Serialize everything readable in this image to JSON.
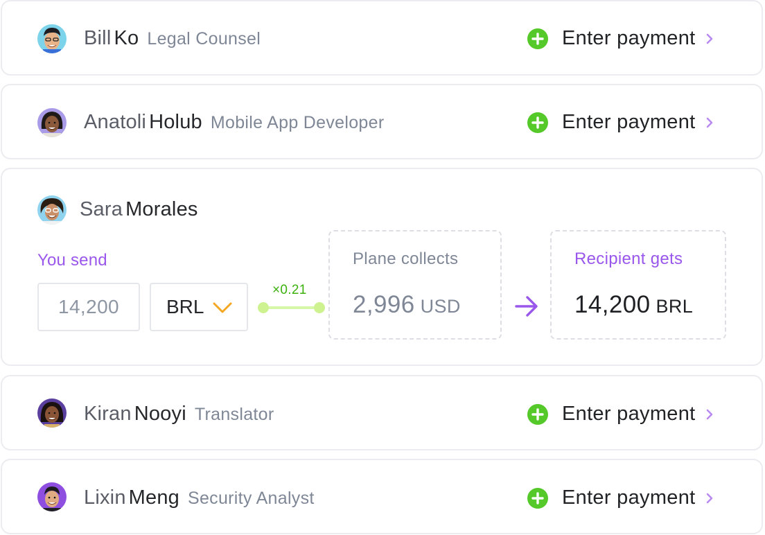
{
  "colors": {
    "accent_purple": "#9a57ec",
    "plus_green": "#56c92a",
    "rate_green": "#3cb10e",
    "rate_line": "#d6f6a8",
    "caret_orange": "#f5a623",
    "card_border": "#ececf0"
  },
  "payees": [
    {
      "first": "Bill",
      "last": "Ko",
      "role": "Legal Counsel",
      "action_label": "Enter payment",
      "action_icon": "plus-circle-icon",
      "chevron_icon": "chevron-right-icon"
    },
    {
      "first": "Anatoli",
      "last": "Holub",
      "role": "Mobile App Developer",
      "action_label": "Enter payment",
      "action_icon": "plus-circle-icon",
      "chevron_icon": "chevron-right-icon"
    },
    {
      "first": "Sara",
      "last": "Morales",
      "expanded": {
        "send_label": "You send",
        "send_amount": "14,200",
        "currency": "BRL",
        "currency_icon": "chevron-down-icon",
        "rate": "×0.21",
        "collect_label": "Plane collects",
        "collect_amount": "2,996",
        "collect_currency": "USD",
        "arrow_icon": "arrow-right-icon",
        "recipient_label": "Recipient gets",
        "recipient_amount": "14,200",
        "recipient_currency": "BRL"
      }
    },
    {
      "first": "Kiran",
      "last": "Nooyi",
      "role": "Translator",
      "action_label": "Enter payment",
      "action_icon": "plus-circle-icon",
      "chevron_icon": "chevron-right-icon"
    },
    {
      "first": "Lixin",
      "last": "Meng",
      "role": "Security Analyst",
      "action_label": "Enter payment",
      "action_icon": "plus-circle-icon",
      "chevron_icon": "chevron-right-icon"
    }
  ]
}
